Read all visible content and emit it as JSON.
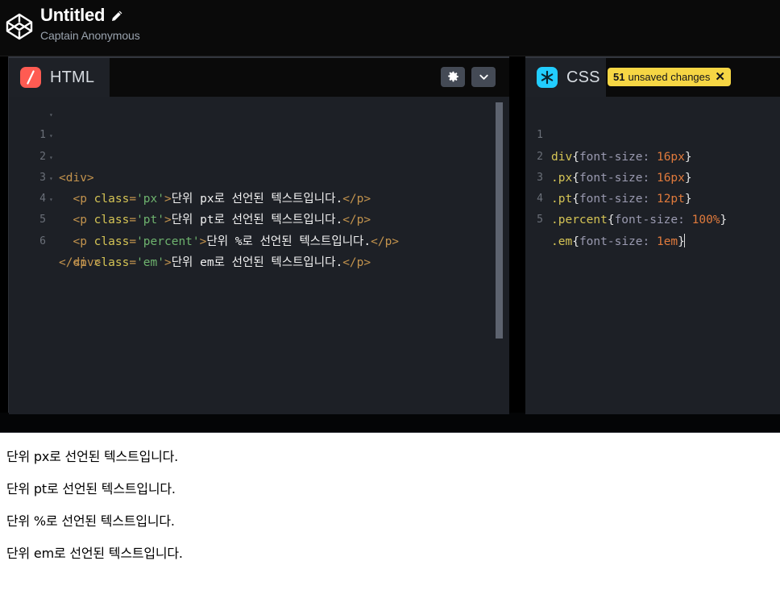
{
  "topbar": {
    "logo_icon": "codepen-logo-icon",
    "title": "Untitled",
    "edit_icon": "pencil-edit-icon",
    "author": "Captain Anonymous"
  },
  "html_panel": {
    "tab_label": "HTML",
    "tab_icon": "html-slash-icon",
    "settings_icon": "gear-icon",
    "collapse_icon": "chevron-down-icon",
    "lines": [
      {
        "num": "1",
        "fold": "▾"
      },
      {
        "num": "2",
        "fold": "▾"
      },
      {
        "num": "3",
        "fold": "▾"
      },
      {
        "num": "4",
        "fold": "▾"
      },
      {
        "num": "5",
        "fold": "▾"
      },
      {
        "num": "6",
        "fold": ""
      }
    ],
    "code": {
      "l1": "<div>",
      "l2": "  <p class='px'>단위 px로 선언된 텍스트입니다.</p>",
      "l3": "  <p class='pt'>단위 pt로 선언된 텍스트입니다.</p>",
      "l4": "  <p class='percent'>단위 %로 선언된 텍스트입니다.</p>",
      "l5": "  <p class='em'>단위 em로 선언된 텍스트입니다.</p>",
      "l6": "</div>"
    },
    "tokens": {
      "div_open": "<div>",
      "div_close": "</div>",
      "p_open_start": "<p ",
      "attr_name": "class",
      "eq": "=",
      "v_px": "'px'",
      "v_pt": "'pt'",
      "v_percent": "'percent'",
      "v_em": "'em'",
      "gt": ">",
      "p_close": "</p>",
      "txt_px": "단위 px로 선언된 텍스트입니다.",
      "txt_pt": "단위 pt로 선언된 텍스트입니다.",
      "txt_percent": "단위 %로 선언된 텍스트입니다.",
      "txt_em": "단위 em로 선언된 텍스트입니다.",
      "indent": "  "
    }
  },
  "css_panel": {
    "tab_label": "CSS",
    "tab_icon": "css-asterisk-icon",
    "badge": {
      "count": "51",
      "text": "unsaved changes",
      "dismiss_icon": "✕"
    },
    "lines": [
      {
        "num": "1"
      },
      {
        "num": "2"
      },
      {
        "num": "3"
      },
      {
        "num": "4"
      },
      {
        "num": "5"
      }
    ],
    "code": {
      "l1": "div{font-size: 16px}",
      "l2": ".px{font-size: 16px}",
      "l3": ".pt{font-size: 12pt}",
      "l4": ".percent{font-size: 100%}",
      "l5": ".em{font-size: 1em}"
    },
    "tokens": {
      "sel_div": "div",
      "sel_px": ".px",
      "sel_pt": ".pt",
      "sel_percent": ".percent",
      "sel_em": ".em",
      "brace_open": "{",
      "brace_close": "}",
      "prop": "font-size: ",
      "val_16px_a": "16px",
      "val_16px_b": "16px",
      "val_12pt": "12pt",
      "val_100pct": "100%",
      "val_1em": "1em"
    }
  },
  "preview": {
    "lines": [
      "단위 px로 선언된 텍스트입니다.",
      "단위 pt로 선언된 텍스트입니다.",
      "단위 %로 선언된 텍스트입니다.",
      "단위 em로 선언된 텍스트입니다."
    ]
  },
  "colors": {
    "accent_html": "#ff5b52",
    "accent_css": "#22cdff",
    "badge_bg": "#f6d644",
    "panel_bg": "#1d2026",
    "header_bg": "#0a0a0a"
  }
}
